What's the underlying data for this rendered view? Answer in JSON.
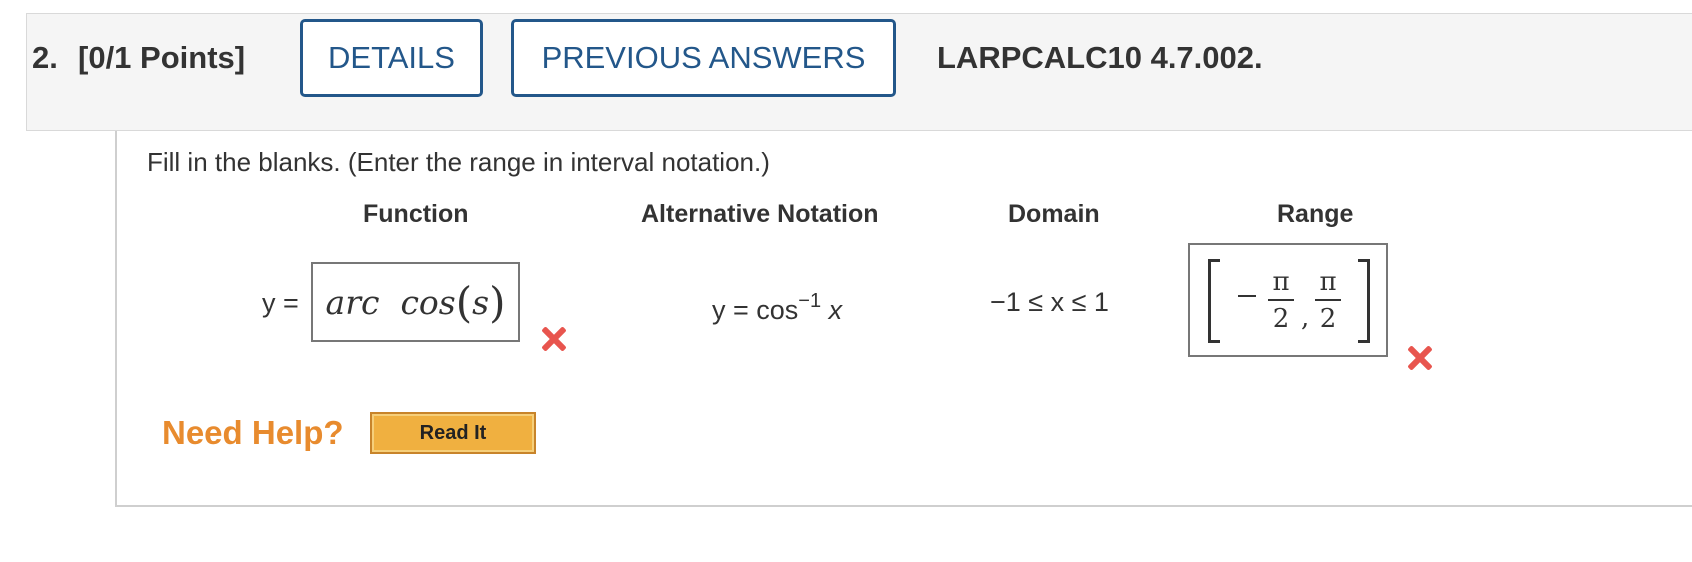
{
  "header": {
    "number": "2.",
    "points": "[0/1 Points]",
    "details_label": "DETAILS",
    "previous_answers_label": "PREVIOUS ANSWERS",
    "code": "LARPCALC10 4.7.002."
  },
  "question": {
    "instructions": "Fill in the blanks. (Enter the range in interval notation.)",
    "columns": [
      "Function",
      "Alternative Notation",
      "Domain",
      "Range"
    ],
    "function_prefix": "y =",
    "function_answer": {
      "name": "arc  cos",
      "open_paren": "(",
      "variable": "s",
      "close_paren": ")"
    },
    "alternative_notation": {
      "lhs": "y = cos",
      "exponent": "−1",
      "variable": "x"
    },
    "domain": "−1 ≤ x ≤ 1",
    "range_answer": {
      "numerator": "π",
      "denominator": "2",
      "comma": ","
    },
    "status_icons": [
      "incorrect-icon",
      "incorrect-icon"
    ]
  },
  "help": {
    "need_help_label": "Need Help?",
    "read_it_label": "Read It"
  },
  "colors": {
    "button_border": "#23578a",
    "need_help": "#e88b2e",
    "read_it_bg": "#f0b040",
    "incorrect": "#e8554e"
  }
}
